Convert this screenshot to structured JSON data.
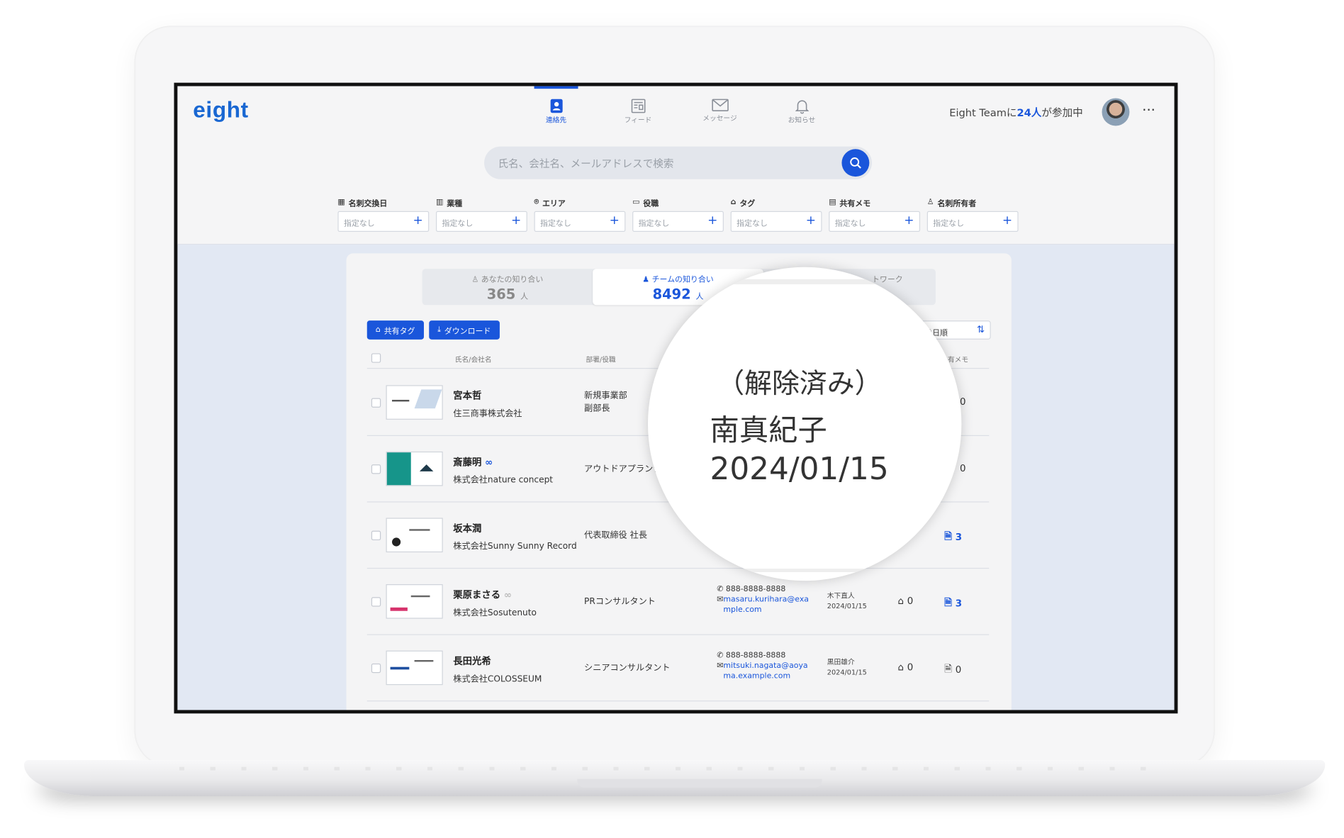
{
  "app": {
    "logo": "eight"
  },
  "nav": [
    {
      "label": "連絡先",
      "icon": "contacts-icon"
    },
    {
      "label": "フィード",
      "icon": "feed-icon"
    },
    {
      "label": "メッセージ",
      "icon": "mail-icon"
    },
    {
      "label": "お知らせ",
      "icon": "bell-icon"
    }
  ],
  "header": {
    "team_prefix": "Eight Teamに",
    "team_count": "24人",
    "team_suffix": "が参加中",
    "more": "···"
  },
  "search": {
    "placeholder": "氏名、会社名、メールアドレスで検索"
  },
  "filters": [
    {
      "label": "名刺交換日",
      "value": "指定なし"
    },
    {
      "label": "業種",
      "value": "指定なし"
    },
    {
      "label": "エリア",
      "value": "指定なし"
    },
    {
      "label": "役職",
      "value": "指定なし"
    },
    {
      "label": "タグ",
      "value": "指定なし"
    },
    {
      "label": "共有メモ",
      "value": "指定なし"
    },
    {
      "label": "名刺所有者",
      "value": "指定なし"
    }
  ],
  "tabs": [
    {
      "label": "あなたの知り合い",
      "count": "365",
      "unit": "人"
    },
    {
      "label": "チームの知り合い",
      "count": "8492",
      "unit": "人"
    },
    {
      "label": "トワーク",
      "count": "",
      "unit": ""
    }
  ],
  "actions": {
    "tag_label": "共有タグ",
    "download_label": "ダウンロード",
    "sort_label": "換日順"
  },
  "columns": {
    "name": "氏名/会社名",
    "dept": "部署/役職",
    "memo": "有メモ"
  },
  "rows": [
    {
      "name": "宮本哲",
      "company": "住三商事株式会社",
      "dept1": "新規事業部",
      "dept2": "副部長",
      "memo": "0"
    },
    {
      "name": "斎藤明",
      "company": "株式会社nature concept",
      "dept1": "アウトドアプランナ",
      "dept2": "",
      "memo": "0",
      "inf": "∞"
    },
    {
      "name": "坂本潤",
      "company": "株式会社Sunny Sunny Record",
      "dept1": "代表取締役 社長",
      "dept2": "",
      "memo": "3"
    },
    {
      "name": "栗原まさる",
      "company": "株式会社Sosutenuto",
      "dept1": "PRコンサルタント",
      "dept2": "",
      "phone": "888-8888-8888",
      "email": "masaru.kurihara@example.com",
      "owner": "木下直人",
      "date": "2024/01/15",
      "tags": "0",
      "memo": "3",
      "inf": "∞"
    },
    {
      "name": "長田光希",
      "company": "株式会社COLOSSEUM",
      "dept1": "シニアコンサルタント",
      "dept2": "",
      "phone": "888-8888-8888",
      "email": "mitsuki.nagata@aoyama.example.com",
      "owner": "黒田雄介",
      "date": "2024/01/15",
      "tags": "0",
      "memo": "0"
    }
  ],
  "magnifier": {
    "line1": "（解除済み）",
    "line2": "南真紀子",
    "line3": "2024/01/15"
  },
  "colors": {
    "accent": "#1a56db",
    "background": "#e2e8f3"
  }
}
